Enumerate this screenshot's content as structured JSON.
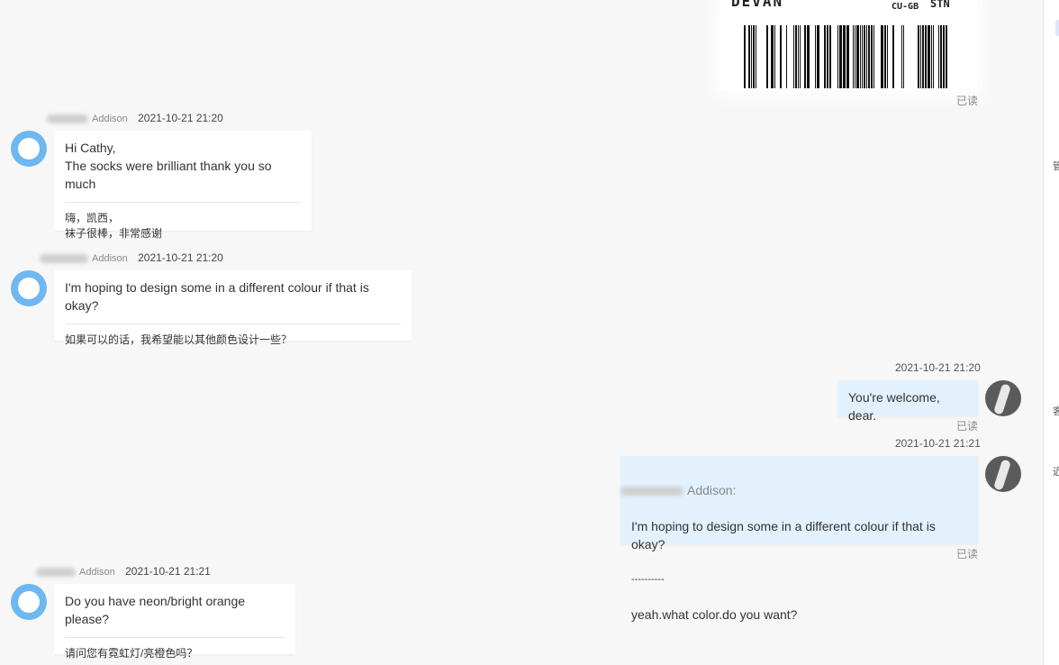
{
  "image_message": {
    "label_big": "DEVAN",
    "label_code": "CU-GB",
    "label_stn": "STN",
    "read": "已读"
  },
  "messages": [
    {
      "name": "Addison",
      "time": "2021-10-21 21:20",
      "text": "Hi Cathy,\nThe socks were brilliant thank you so much",
      "translation": "嗨，凯西，\n袜子很棒，非常感谢"
    },
    {
      "name": "Addison",
      "time": "2021-10-21 21:20",
      "text": "I'm hoping to design some in a different colour if that is okay?",
      "translation": "如果可以的话，我希望能以其他颜色设计一些？"
    },
    {
      "time": "2021-10-21 21:20",
      "text": "You're welcome, dear.",
      "read": "已读"
    },
    {
      "time": "2021-10-21 21:21",
      "quote_name": "Addison:",
      "quote_text": "I'm hoping to design some in a different colour if that is okay?",
      "divider": "----------",
      "text": "yeah.what color.do you want?",
      "read": "已读"
    },
    {
      "name": "Addison",
      "time": "2021-10-21 21:21",
      "text": "Do you have neon/bright orange please?",
      "translation": "请问您有霓虹灯/亮橙色吗？"
    }
  ],
  "right_panel": {
    "chars": [
      "管",
      "客",
      "近"
    ]
  },
  "colors": {
    "background": "#f7f7f7",
    "incoming_bubble": "#ffffff",
    "outgoing_bubble": "#e3f1fd",
    "avatar_blue": "#6fb7f0"
  }
}
